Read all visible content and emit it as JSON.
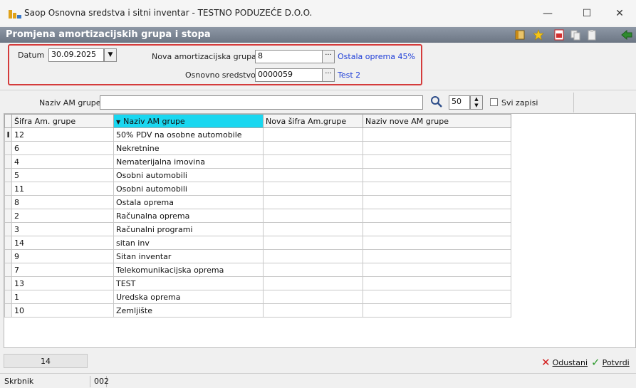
{
  "window": {
    "title": "Saop Osnovna sredstva i sitni inventar - TESTNO PODUZEĆE D.O.O.",
    "minimize": "—",
    "maximize": "☐",
    "close": "✕"
  },
  "header": {
    "title": "Promjena amortizacijskih grupa i stopa",
    "toolbar_icons": [
      "layout-icon",
      "star-icon",
      "pdf-icon",
      "copy-icon",
      "paste-icon",
      "exit-icon"
    ]
  },
  "filter": {
    "datum_label": "Datum",
    "datum_value": "30.09.2025",
    "nova_grupa_label": "Nova amortizacijska grupa",
    "nova_grupa_value": "8",
    "nova_grupa_link": "Ostala oprema 45%",
    "sredstvo_label": "Osnovno sredstvo",
    "sredstvo_value": "0000059",
    "sredstvo_link": "Test 2",
    "dots": "···"
  },
  "search": {
    "label": "Naziv AM grupe",
    "value": "",
    "count_value": "50",
    "svi_zapisi_label": "Svi zapisi"
  },
  "grid": {
    "columns": [
      "Šifra Am. grupe",
      "Naziv AM grupe",
      "Nova šifra Am.grupe",
      "Naziv nove AM grupe"
    ],
    "sort_arrow": "▼",
    "current_row_marker": "I",
    "rows": [
      {
        "sifra": "12",
        "naziv": "50% PDV na osobne automobile",
        "nova_sifra": "",
        "naziv_nove": ""
      },
      {
        "sifra": "6",
        "naziv": "Nekretnine",
        "nova_sifra": "",
        "naziv_nove": ""
      },
      {
        "sifra": "4",
        "naziv": "Nematerijalna imovina",
        "nova_sifra": "",
        "naziv_nove": ""
      },
      {
        "sifra": "5",
        "naziv": "Osobni automobili",
        "nova_sifra": "",
        "naziv_nove": ""
      },
      {
        "sifra": "11",
        "naziv": "Osobni automobili",
        "nova_sifra": "",
        "naziv_nove": ""
      },
      {
        "sifra": "8",
        "naziv": "Ostala oprema",
        "nova_sifra": "",
        "naziv_nove": ""
      },
      {
        "sifra": "2",
        "naziv": "Računalna oprema",
        "nova_sifra": "",
        "naziv_nove": ""
      },
      {
        "sifra": "3",
        "naziv": "Računalni programi",
        "nova_sifra": "",
        "naziv_nove": ""
      },
      {
        "sifra": "14",
        "naziv": "sitan inv",
        "nova_sifra": "",
        "naziv_nove": ""
      },
      {
        "sifra": "9",
        "naziv": "Sitan inventar",
        "nova_sifra": "",
        "naziv_nove": ""
      },
      {
        "sifra": "7",
        "naziv": "Telekomunikacijska oprema",
        "nova_sifra": "",
        "naziv_nove": ""
      },
      {
        "sifra": "13",
        "naziv": "TEST",
        "nova_sifra": "",
        "naziv_nove": ""
      },
      {
        "sifra": "1",
        "naziv": "Uredska oprema",
        "nova_sifra": "",
        "naziv_nove": ""
      },
      {
        "sifra": "10",
        "naziv": "Zemljište",
        "nova_sifra": "",
        "naziv_nove": ""
      }
    ]
  },
  "footer": {
    "record_count": "14",
    "odustani_label": "Odustani",
    "potvrdi_label": "Potvrdi"
  },
  "statusbar": {
    "user_label": "Skrbnik",
    "user_code": "002"
  },
  "colors": {
    "highlight_border": "#d43b3b",
    "sorted_column": "#19d7f0",
    "link": "#1f3fd8",
    "header_bar": "#7a8492"
  }
}
